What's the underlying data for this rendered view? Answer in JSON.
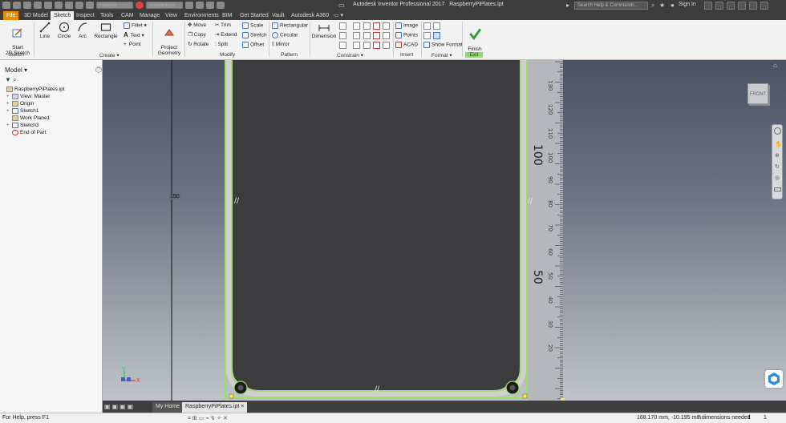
{
  "window": {
    "app_title": "Autodesk Inventor Professional 2017",
    "document_title": "RaspberryPiPlates.ipt",
    "search_placeholder": "Search Help & Commands...",
    "sign_in": "Sign In",
    "material_combo": "Material",
    "appearance_combo": "Appearance"
  },
  "menu_tabs": [
    "File",
    "3D Model",
    "Sketch",
    "Inspect",
    "Tools",
    "CAM",
    "Manage",
    "View",
    "Environments",
    "BIM",
    "Get Started",
    "Vault",
    "Autodesk A360"
  ],
  "active_tab": "Sketch",
  "ribbon": {
    "sketch_group": {
      "label": "Sketch",
      "start_2d": "Start\n2D Sketch"
    },
    "create_group": {
      "label": "Create ▾",
      "line": "Line",
      "circle": "Circle",
      "arc": "Arc",
      "rectangle": "Rectangle",
      "fillet": "Fillet ▾",
      "text": "Text ▾",
      "point": "Point"
    },
    "project_geometry": "Project\nGeometry",
    "modify_group": {
      "label": "Modify",
      "move": "Move",
      "copy": "Copy",
      "rotate": "Rotate",
      "trim": "Trim",
      "extend": "Extend",
      "split": "Split",
      "scale": "Scale",
      "stretch": "Stretch",
      "offset": "Offset"
    },
    "pattern_group": {
      "label": "Pattern",
      "rectangular": "Rectangular",
      "circular": "Circular",
      "mirror": "Mirror"
    },
    "constrain_group": {
      "label": "Constrain ▾",
      "dimension": "Dimension"
    },
    "insert_group": {
      "label": "Insert",
      "image": "Image",
      "points": "Points",
      "acad": "ACAD"
    },
    "format_group": {
      "label": "Format ▾",
      "show_format": "Show Format"
    },
    "exit_group": {
      "label": "Exit",
      "finish_sketch": "Finish\nSketch"
    }
  },
  "browser": {
    "title": "Model ▾",
    "help": "?",
    "nodes": [
      {
        "label": "RaspberryPiPlates.ipt",
        "indent": 0,
        "expander": ""
      },
      {
        "label": "View: Master",
        "indent": 1,
        "expander": "+"
      },
      {
        "label": "Origin",
        "indent": 1,
        "expander": "+"
      },
      {
        "label": "Sketch1",
        "indent": 1,
        "expander": "+"
      },
      {
        "label": "Work Plane1",
        "indent": 1,
        "expander": ""
      },
      {
        "label": "Sketch3",
        "indent": 1,
        "expander": "+"
      },
      {
        "label": "End of Part",
        "indent": 1,
        "expander": ""
      }
    ]
  },
  "viewport": {
    "dimension_label": "150",
    "viewcube_label": "FRONT",
    "ruler_labels": [
      "130",
      "120",
      "110",
      "100",
      "90",
      "80",
      "70",
      "60",
      "50",
      "40",
      "30",
      "20"
    ],
    "ruler_big_labels": [
      "100",
      "50"
    ],
    "colors": {
      "sketch_green": "#9be05a",
      "plate_fill": "#3c3c3e",
      "accent": "#e98b00"
    }
  },
  "doc_tabs": [
    "My Home",
    "RaspberryPiPlates.ipt"
  ],
  "status": {
    "help": "For Help, press F1",
    "coords": "168.170 mm, -10.195 mm",
    "dims_needed": "7 dimensions needed",
    "count_a": "1",
    "count_b": "1"
  }
}
